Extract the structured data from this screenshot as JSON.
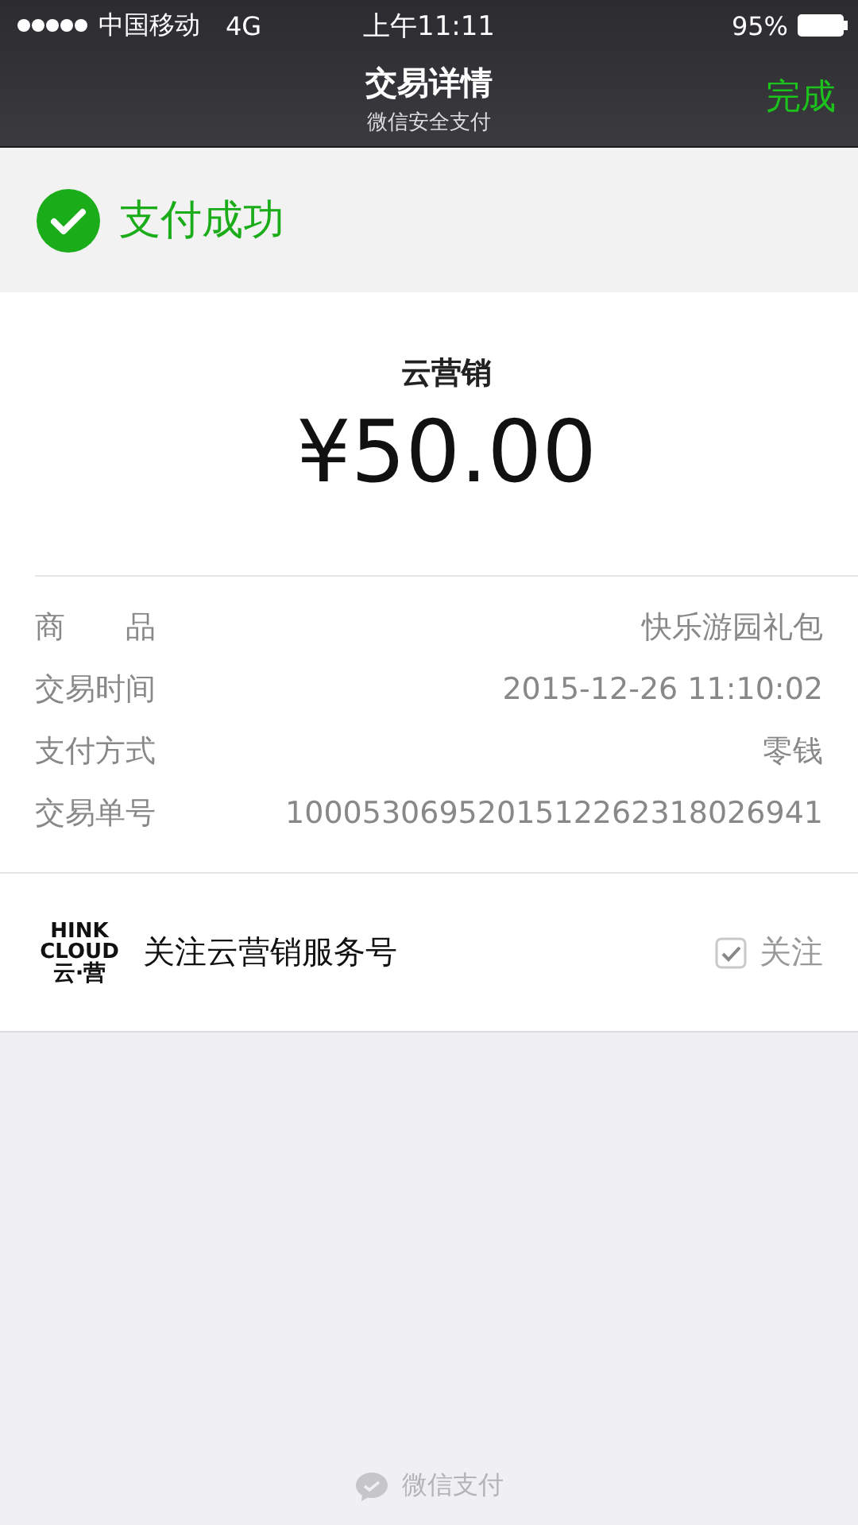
{
  "status_bar": {
    "carrier": "中国移动",
    "network": "4G",
    "time": "上午11:11",
    "battery": "95%"
  },
  "nav": {
    "title": "交易详情",
    "subtitle": "微信安全支付",
    "action": "完成"
  },
  "result": {
    "text": "支付成功"
  },
  "payment": {
    "merchant": "云营销",
    "amount": "¥50.00"
  },
  "details": [
    {
      "label": "商　　品",
      "value": "快乐游园礼包"
    },
    {
      "label": "交易时间",
      "value": "2015-12-26 11:10:02"
    },
    {
      "label": "支付方式",
      "value": "零钱"
    },
    {
      "label": "交易单号",
      "value": "1000530695201512262318026941"
    }
  ],
  "follow": {
    "logo_lines": [
      "HINK",
      "CLOUD",
      "云·营"
    ],
    "text": "关注云营销服务号",
    "checked": true,
    "label": "关注"
  },
  "footer": {
    "text": "微信支付"
  }
}
